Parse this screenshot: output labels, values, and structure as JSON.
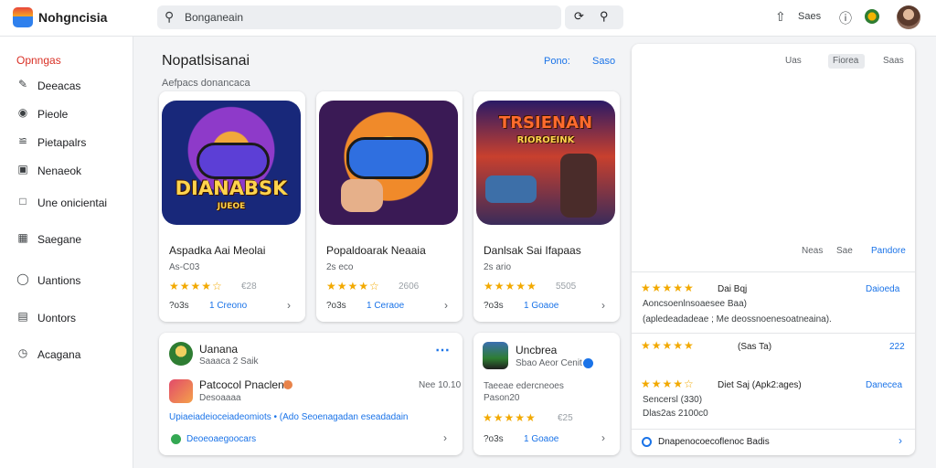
{
  "app": {
    "title": "Nohgncisia"
  },
  "search": {
    "placeholder": "Bonganeain"
  },
  "top_actions": {
    "refresh_icon": "refresh-icon",
    "search_icon": "search-icon",
    "text": "Saes"
  },
  "sidebar": {
    "heading": "Opnngas",
    "items": [
      {
        "label": "Deeacas",
        "icon": "pencil-icon"
      },
      {
        "label": "Pieole",
        "icon": "globe-icon"
      },
      {
        "label": "Pietapalrs",
        "icon": "chart-icon"
      },
      {
        "label": "Nenaeok",
        "icon": "calendar-icon"
      },
      {
        "label": "Une onicientai",
        "icon": "chat-icon"
      },
      {
        "label": "Saegane",
        "icon": "grid-icon"
      },
      {
        "label": "Uantions",
        "icon": "chat-bubble-icon"
      },
      {
        "label": "Uontors",
        "icon": "list-icon"
      },
      {
        "label": "Acagana",
        "icon": "clock-icon"
      }
    ]
  },
  "main": {
    "title": "Nopatlsisanai",
    "subtitle": "Aefpacs donancaca",
    "link_a": "Pono:",
    "link_b": "Saso"
  },
  "cards": [
    {
      "art_text": "DIANABSK",
      "art_sub": "JUEOE",
      "title": "Aspadka Aai Meolai",
      "meta": "As-C03",
      "rating_count": "€28",
      "foot_left": "?o3s",
      "foot_link": "1 Creono"
    },
    {
      "art_text": "",
      "art_sub": "",
      "title": "Popaldoarak Neaaia",
      "meta": "2s eco",
      "rating_count": "2606",
      "foot_left": "?o3s",
      "foot_link": "1 Ceraoe"
    },
    {
      "art_text": "TRSIENAN",
      "art_sub": "RIOROEINK",
      "title": "Danlsak Sai Ifapaas",
      "meta": "2s ario",
      "rating_count": "5505",
      "foot_left": "?o3s",
      "foot_link": "1 Goaoe"
    }
  ],
  "feed_left": {
    "user_name": "Uanana",
    "user_meta": "Saaaca 2 Saik",
    "app_name": "Patcocol Pnacleni",
    "app_meta": "Desoaaaa",
    "app_time": "Nee 10.10",
    "desc": "Upiaeiadeioceiadeomiots • (Ado Seoenagadan eseadadain",
    "footer": "Deoeoaegoocars"
  },
  "feed_mid": {
    "user_name": "Uncbrea",
    "user_meta": "Sbao Aeor Cenit",
    "line1": "Taeeae edercneoes",
    "line2": "Pason20",
    "rating_count": "€25",
    "foot_left": "?o3s",
    "foot_link": "1 Goaoe"
  },
  "right_panel": {
    "tabs": [
      "Uas",
      "Fiorea",
      "Saas"
    ],
    "mini_a": "Neas",
    "mini_b": "Sae",
    "mini_link": "Pandore",
    "reviews": [
      {
        "title": "Dai Bqj",
        "line1": "Aoncsoenlnsoaesee Baa)",
        "line2": "(apledeadadeae ; Me deossnoenesoatneaina).",
        "action": "Daioeda"
      },
      {
        "title": "(Sas Ta)",
        "line1": "",
        "line2": "",
        "action": "222"
      },
      {
        "title": "Diet Saj (Apk2:ages)",
        "line1": "Sencersl (330)",
        "line2": "Dlas2as 2100c0",
        "action": "Danecea"
      }
    ],
    "footer": "Dnapenocoecoflenoc Badis"
  },
  "colors": {
    "accent": "#1a73e8",
    "star": "#f2a900",
    "heading_red": "#d93025"
  }
}
